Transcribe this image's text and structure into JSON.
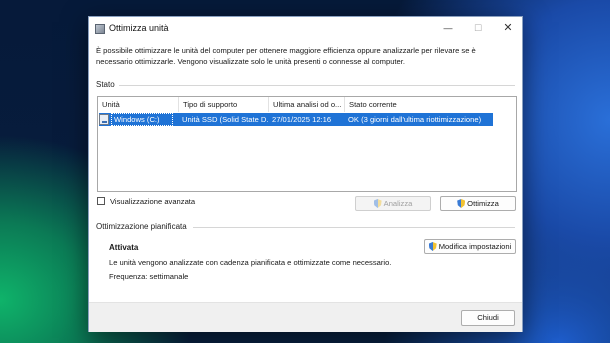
{
  "window": {
    "title": "Ottimizza unità",
    "controls": {
      "minimize": "—",
      "maximize": "☐",
      "close": "✕"
    },
    "description": "È possibile ottimizzare le unità del computer per ottenere maggiore efficienza oppure analizzarle per rilevare se è necessario ottimizzarle. Vengono visualizzate solo le unità presenti o connesse al computer."
  },
  "status": {
    "section_label": "Stato",
    "columns": [
      "Unità",
      "Tipo di supporto",
      "Ultima analisi od o...",
      "Stato corrente"
    ],
    "rows": [
      {
        "drive": "Windows (C:)",
        "media_type": "Unità SSD (Solid State D...",
        "last_run": "27/01/2025 12:16",
        "current_status": "OK (3 giorni dall'ultima riottimizzazione)",
        "selected": true,
        "icon": "drive-icon"
      }
    ]
  },
  "advanced_view_label": "Visualizzazione avanzata",
  "buttons": {
    "analyze": "Analizza",
    "optimize": "Ottimizza",
    "change_settings": "Modifica impostazioni",
    "close": "Chiudi"
  },
  "scheduled": {
    "section_label": "Ottimizzazione pianificata",
    "state": "Attivata",
    "description": "Le unità vengono analizzate con cadenza pianificata e ottimizzate come necessario.",
    "frequency": "Frequenza: settimanale"
  },
  "colors": {
    "selection": "#1f73d6",
    "window_bg": "#ffffff",
    "footer_bg": "#f0f0f0"
  }
}
